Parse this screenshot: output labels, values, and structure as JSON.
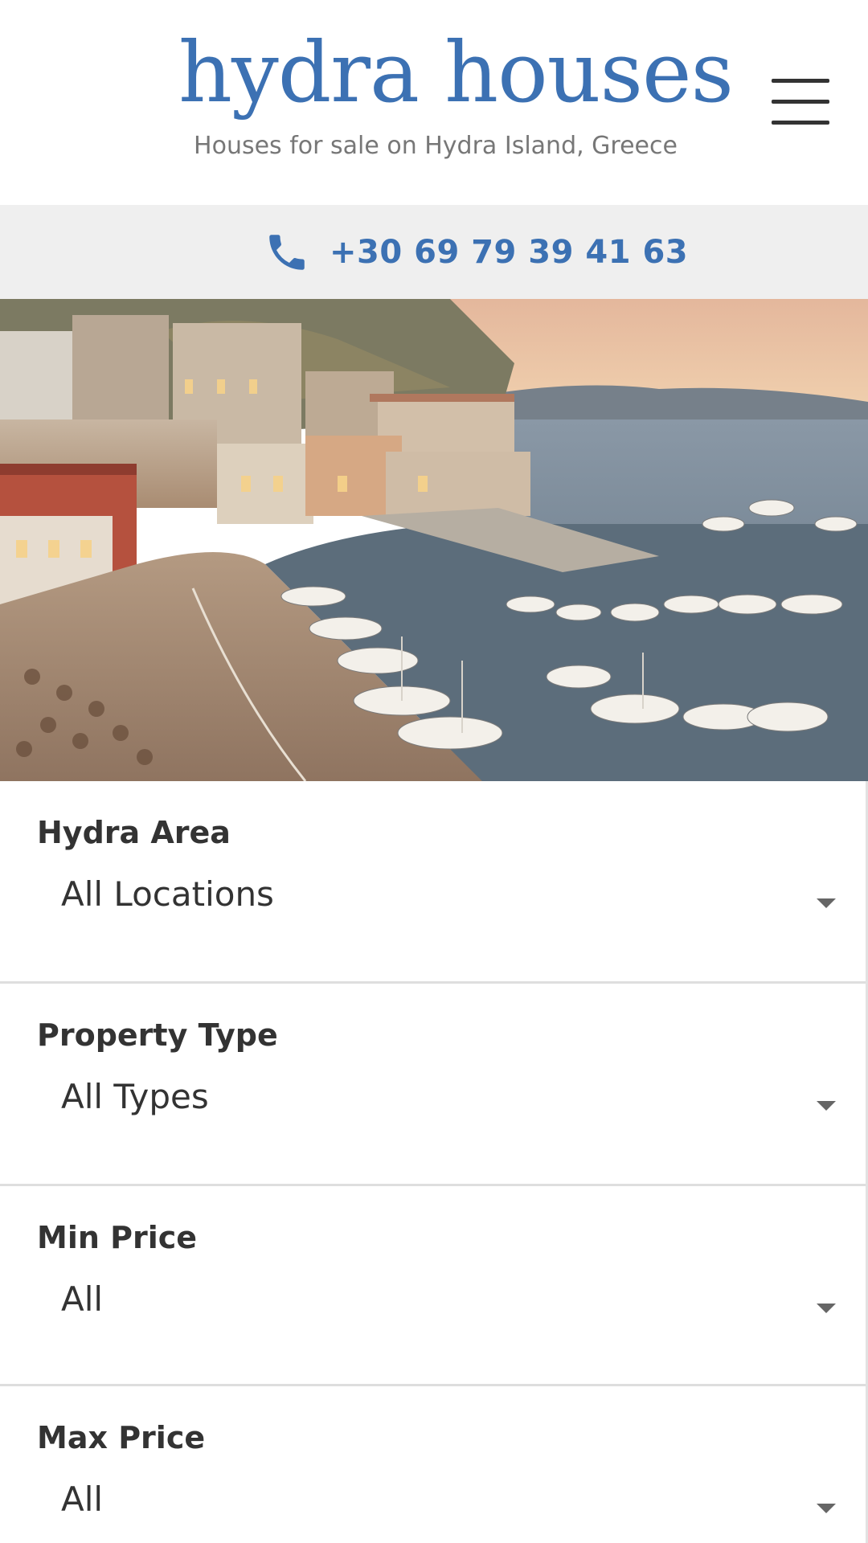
{
  "header": {
    "logo_title": "hydra houses",
    "logo_tagline": "Houses for sale on Hydra Island, Greece",
    "menu_icon": "hamburger-menu-icon"
  },
  "contact": {
    "phone_icon": "phone-icon",
    "phone_number": "+30 69 79 39 41 63"
  },
  "colors": {
    "brand_blue": "#3c71b3",
    "phone_bar_bg": "#efefef",
    "text_dark": "#333333"
  },
  "search": {
    "filters": [
      {
        "label": "Hydra Area",
        "value": "All Locations"
      },
      {
        "label": "Property Type",
        "value": "All Types"
      },
      {
        "label": "Min Price",
        "value": "All"
      },
      {
        "label": "Max Price",
        "value": "All"
      }
    ]
  }
}
